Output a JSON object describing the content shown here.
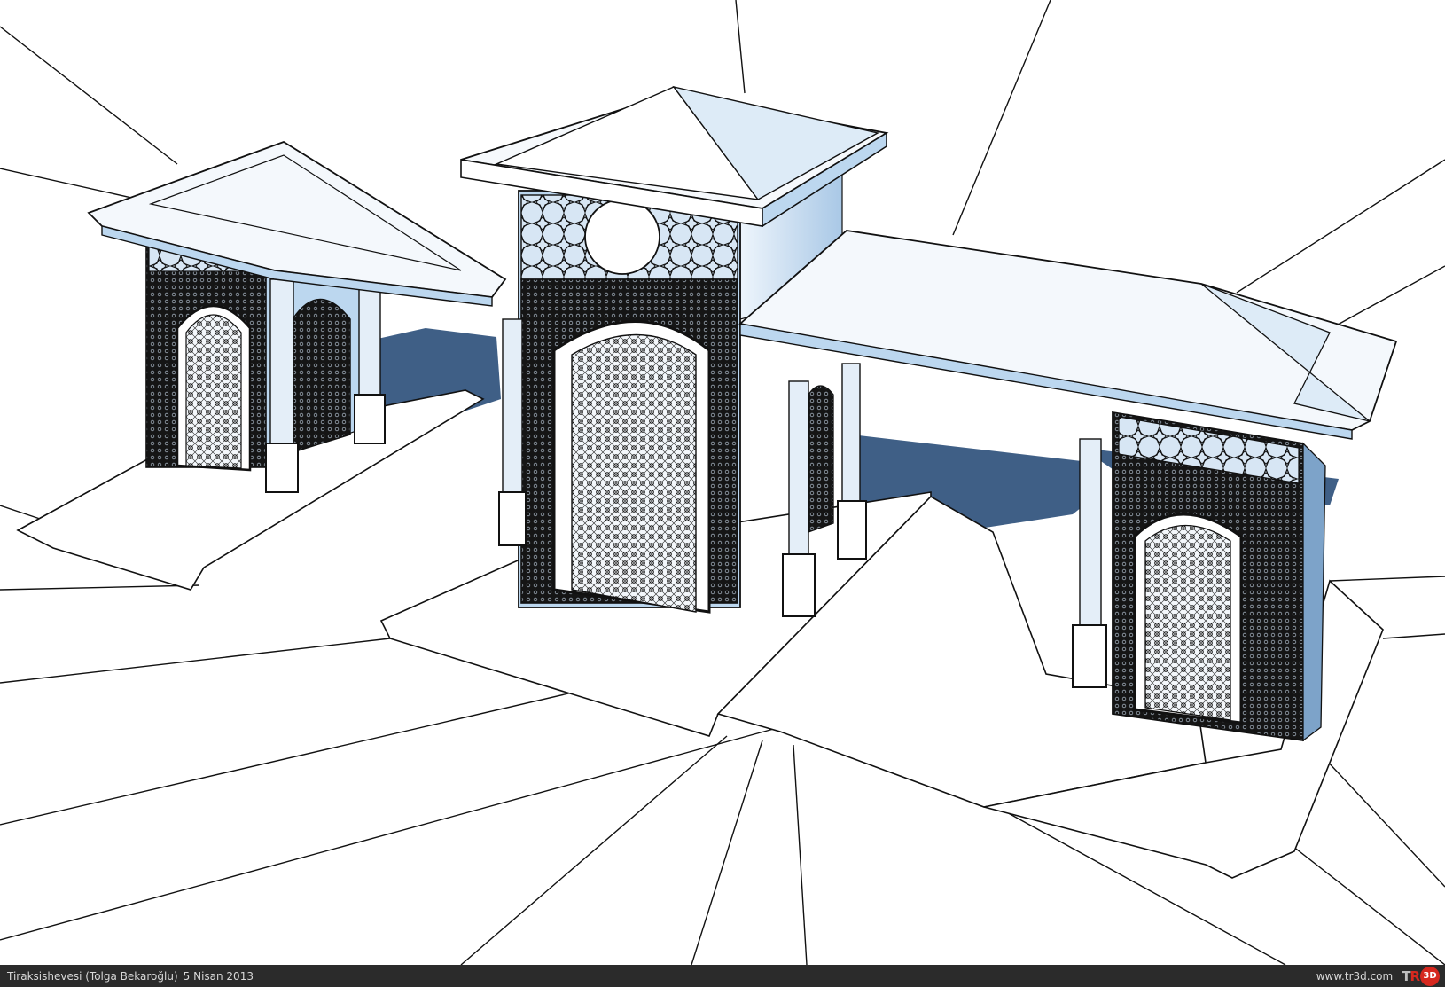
{
  "caption": {
    "title": "Tiraksishevesi (Tolga Bekaroğlu)",
    "date": "5 Nisan 2013",
    "site_url": "www.tr3d.com",
    "logo_letters_a": "T",
    "logo_letters_b": "R",
    "logo_letters_c": "3D"
  },
  "colors": {
    "sky_blue": "#bcd7ef",
    "shadow_blue": "#3f5f86",
    "ink": "#111111",
    "bar_bg": "#2b2b2b",
    "logo_red": "#d6281e"
  }
}
